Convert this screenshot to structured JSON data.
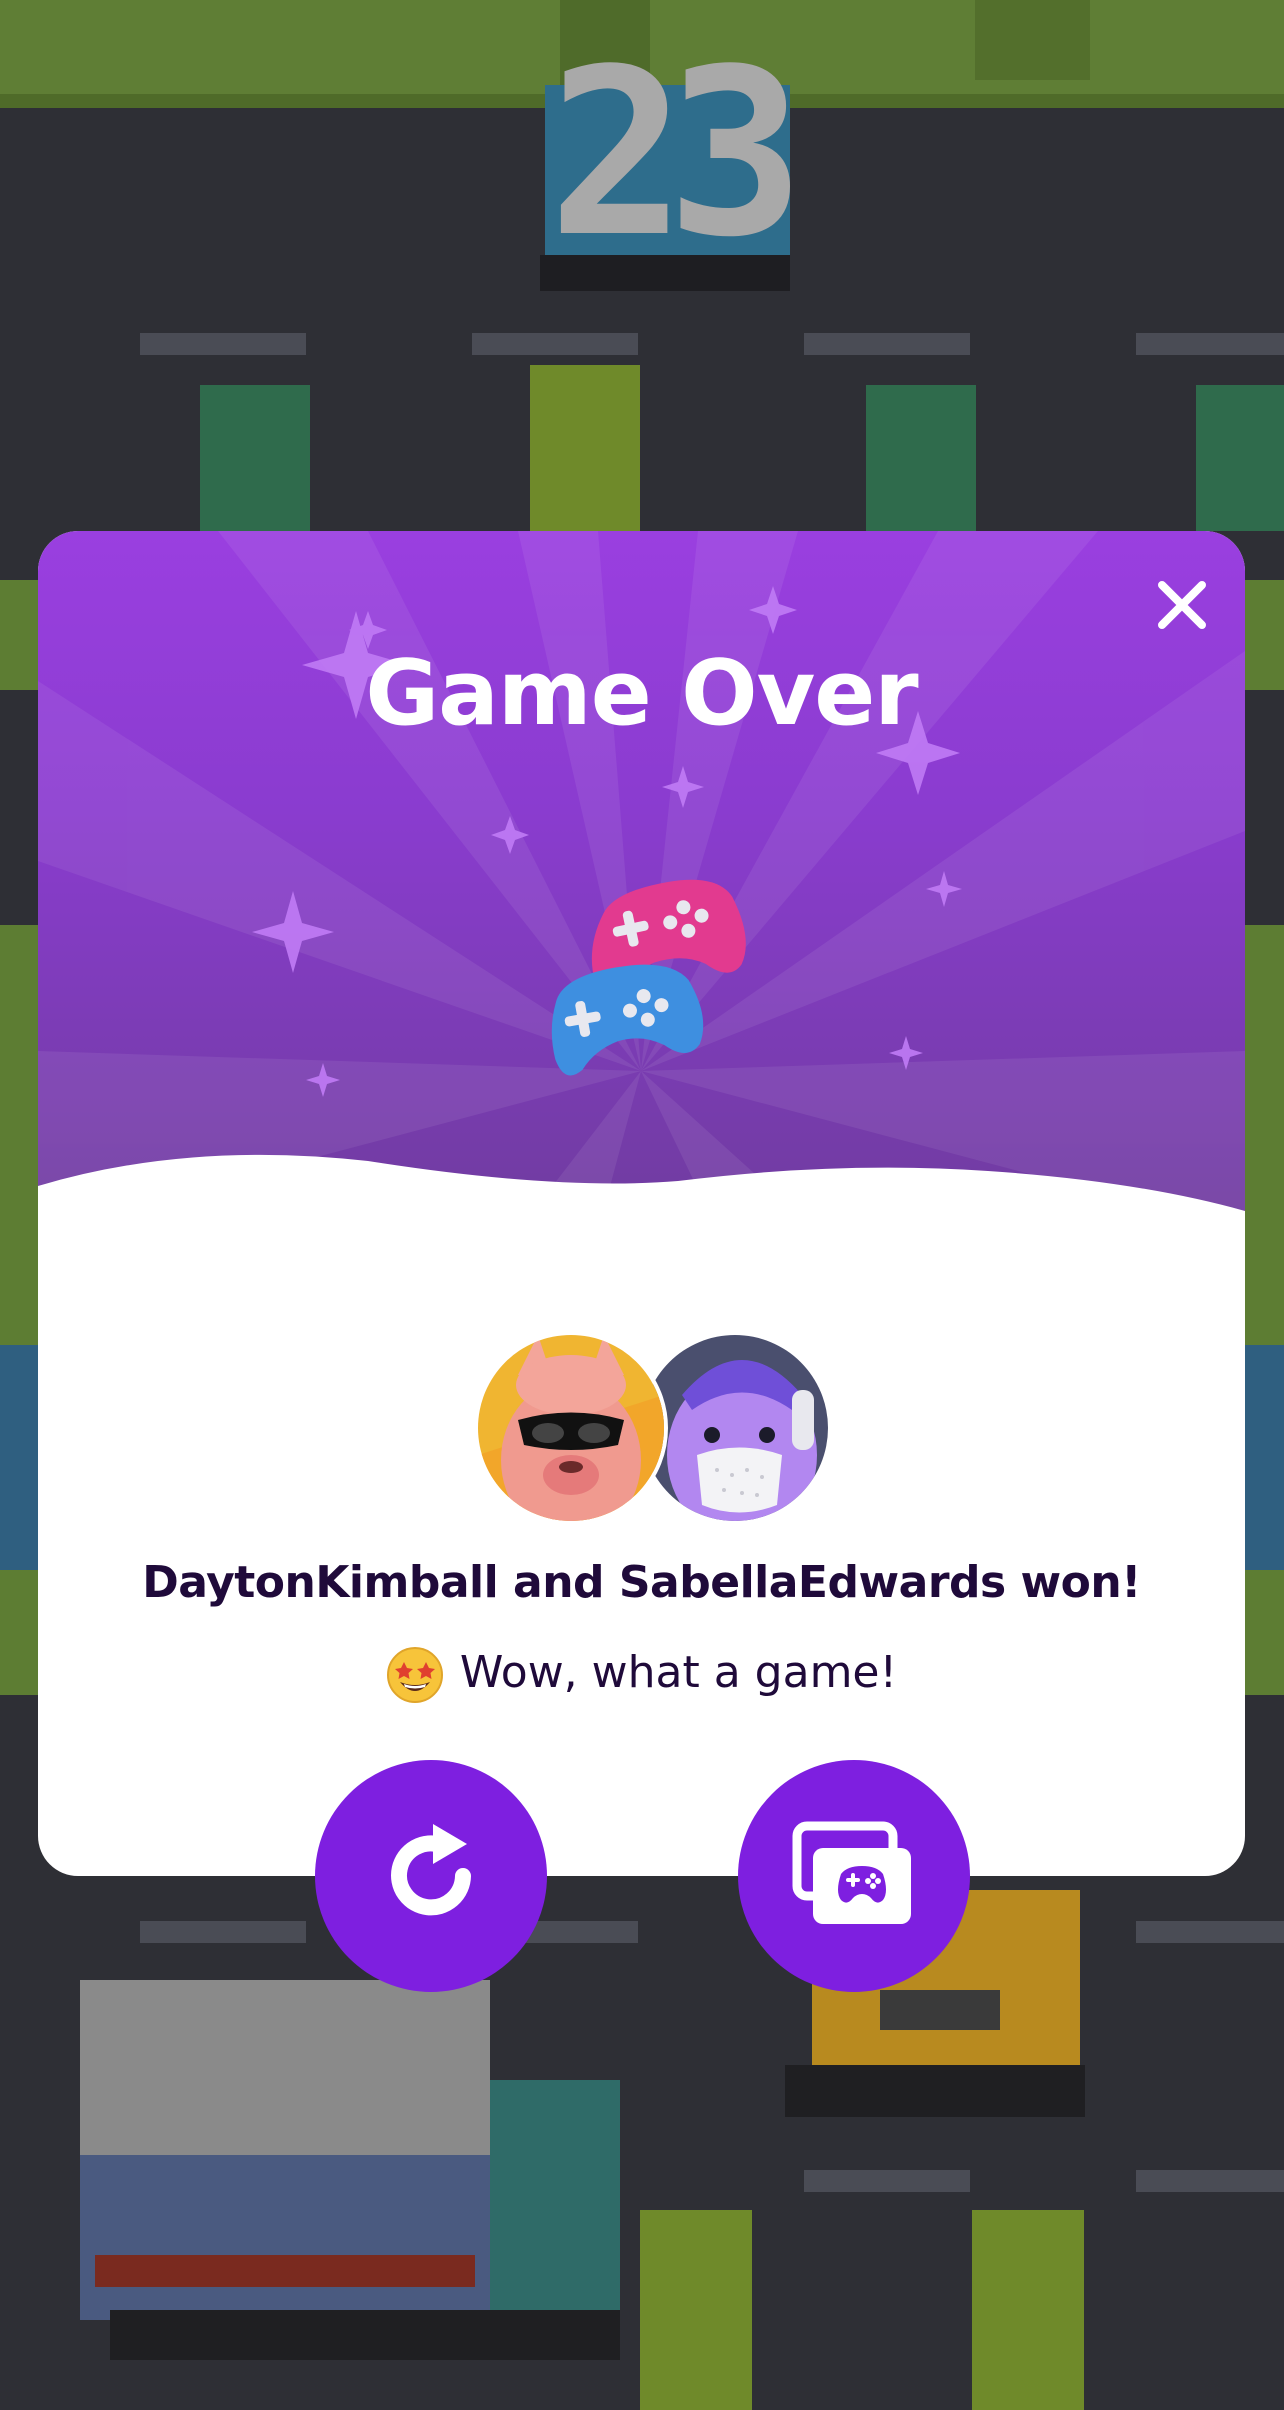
{
  "game": {
    "score": "23"
  },
  "dialog": {
    "title": "Game Over",
    "winner_text": "DaytonKimball and SabellaEdwards won!",
    "subtext": "Wow, what a game!",
    "emoji_icon": "star-struck-emoji-icon",
    "close_icon": "close-icon",
    "header_icon": "game-controllers-icon",
    "players": [
      "DaytonKimball",
      "SabellaEdwards"
    ]
  },
  "actions": {
    "replay_icon": "replay-icon",
    "more_games_icon": "more-games-icon"
  },
  "colors": {
    "accent": "#7e1fe0",
    "header_top": "#9a3fe0",
    "header_bottom": "#6f3c9e",
    "text_dark": "#1f0a3a"
  }
}
